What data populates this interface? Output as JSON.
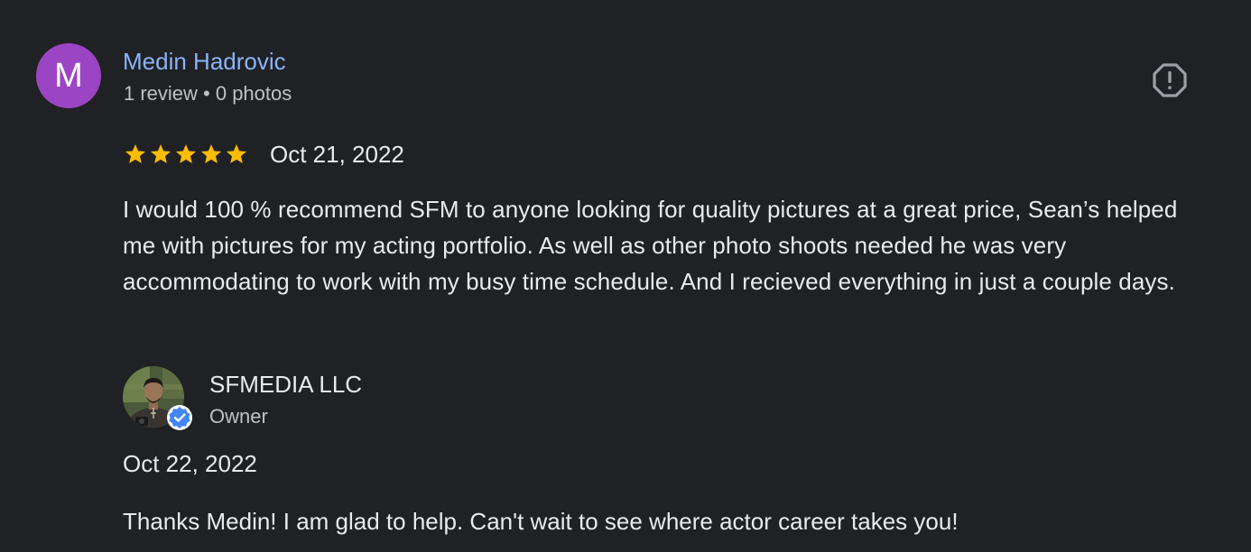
{
  "reviewer": {
    "initial": "M",
    "name": "Medin Hadrovic",
    "meta": "1 review • 0 photos",
    "avatar_color": "#9b45c4"
  },
  "report_icon": "report-flag-icon",
  "review": {
    "rating": 5,
    "rating_max": 5,
    "date": "Oct 21, 2022",
    "text": "I would 100 % recommend SFM to anyone looking for quality pictures at a great price, Sean’s helped me with pictures for my acting portfolio. As well as other photo shoots needed he was very accommodating to work with my busy time schedule. And I recieved everything in just a couple days."
  },
  "owner_reply": {
    "name": "SFMEDIA LLC",
    "role": "Owner",
    "date": "Oct 22, 2022",
    "text": "Thanks Medin! I am glad to help. Can't wait to see where actor career takes you!",
    "verified_icon": "verified-badge-icon"
  },
  "colors": {
    "background": "#202124",
    "link": "#8ab4f8",
    "star": "#fbbc04",
    "verified": "#4285f4"
  }
}
